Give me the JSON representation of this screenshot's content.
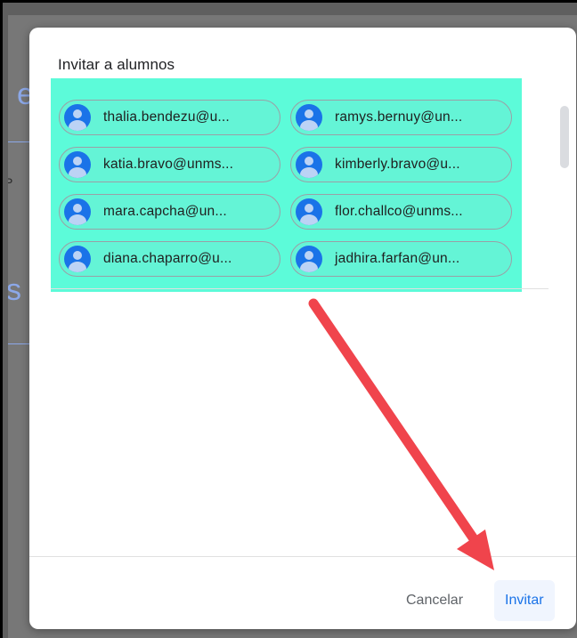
{
  "background": {
    "fragment_top": "e",
    "fragment_mid": "P",
    "fragment_bottom": "s"
  },
  "dialog": {
    "title": "Invitar a alumnos",
    "chips": [
      "thalia.bendezu@u...",
      "ramys.bernuy@un...",
      "katia.bravo@unms...",
      "kimberly.bravo@u...",
      "mara.capcha@un...",
      "flor.challco@unms...",
      "diana.chaparro@u...",
      "jadhira.farfan@un..."
    ],
    "cancel_label": "Cancelar",
    "invite_label": "Invitar"
  },
  "colors": {
    "highlight": "#5cfbd9",
    "accent": "#1a73e8",
    "annotation_arrow": "#f0444c"
  }
}
